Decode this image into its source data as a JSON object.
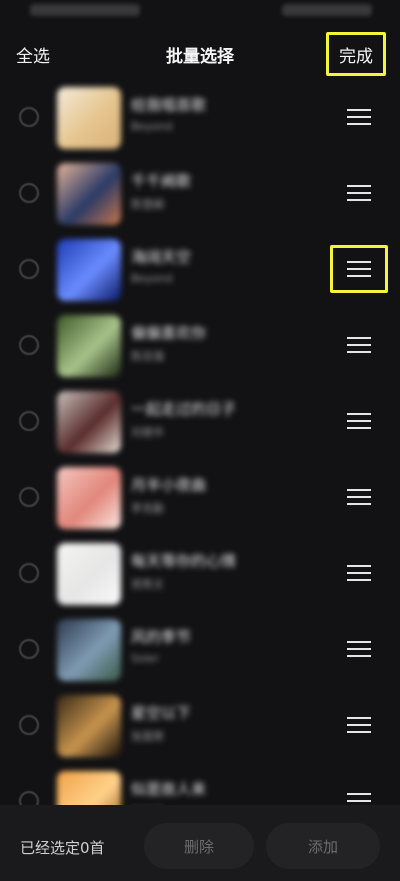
{
  "header": {
    "select_all": "全选",
    "title": "批量选择",
    "done": "完成"
  },
  "songs": [
    {
      "title": "给我唱首歌",
      "artist": "Beyond",
      "cover_colors": [
        "#f3eadb",
        "#e6c58e",
        "#d9b27a"
      ]
    },
    {
      "title": "千千阙歌",
      "artist": "陈慧娴",
      "cover_colors": [
        "#e6b59a",
        "#2a3a66",
        "#c9774c"
      ]
    },
    {
      "title": "海阔天空",
      "artist": "Beyond",
      "cover_colors": [
        "#1f3cb5",
        "#6a8cff",
        "#0c1a66"
      ]
    },
    {
      "title": "偏偏喜欢你",
      "artist": "陈百强",
      "cover_colors": [
        "#3e5a2a",
        "#a8c38a",
        "#1d2a15"
      ]
    },
    {
      "title": "一起走过的日子",
      "artist": "刘德华",
      "cover_colors": [
        "#c9c2bd",
        "#5a2c2c",
        "#e9e0d6"
      ]
    },
    {
      "title": "月半小夜曲",
      "artist": "李克勤",
      "cover_colors": [
        "#f4c7c0",
        "#e2867a",
        "#fbe8e2"
      ]
    },
    {
      "title": "每天等你的心情",
      "artist": "郑秀文",
      "cover_colors": [
        "#f4f4f2",
        "#e6e6e6",
        "#fafafa"
      ]
    },
    {
      "title": "风的季节",
      "artist": "Soler",
      "cover_colors": [
        "#2e3b4e",
        "#7f9bb4",
        "#3a5a46"
      ]
    },
    {
      "title": "星空以下",
      "artist": "张国荣",
      "cover_colors": [
        "#3a2a18",
        "#c8944e",
        "#1a130c"
      ]
    },
    {
      "title": "似是故人来",
      "artist": "梅艳芳",
      "cover_colors": [
        "#f0a24a",
        "#ffd28a",
        "#8a4a1a"
      ]
    }
  ],
  "bottom": {
    "selected_count": "已经选定0首",
    "delete": "删除",
    "add": "添加"
  },
  "colors": {
    "background": "#121214",
    "highlight": "#f4f43a",
    "bottom_bar": "#1a1a1c",
    "button": "#232325"
  }
}
